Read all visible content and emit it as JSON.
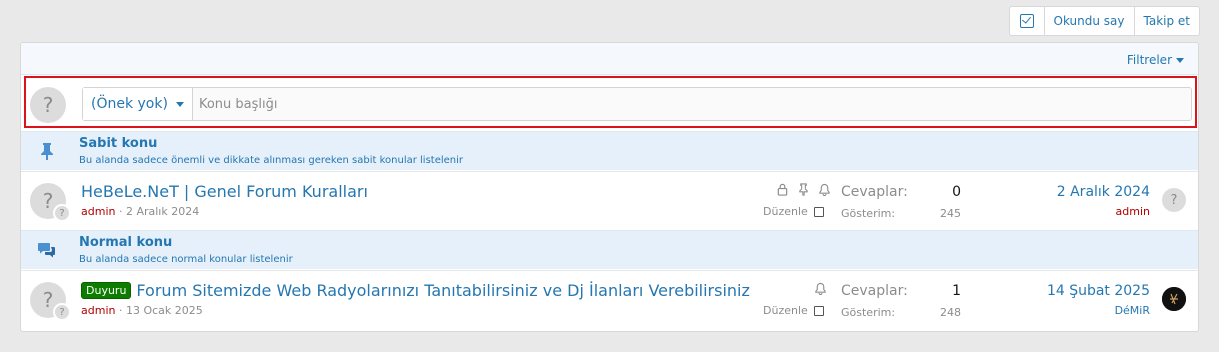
{
  "toolbar": {
    "mark_read_label": "Okundu say",
    "watch_label": "Takip et"
  },
  "filters": {
    "label": "Filtreler"
  },
  "quick_thread": {
    "avatar_glyph": "?",
    "prefix_label": "(Önek yok)",
    "title_placeholder": "Konu başlığı"
  },
  "sections": {
    "sticky": {
      "title": "Sabit konu",
      "description": "Bu alanda sadece önemli ve dikkate alınması gereken sabit konular listelenir"
    },
    "normal": {
      "title": "Normal konu",
      "description": "Bu alanda sadece normal konular listelenir"
    }
  },
  "threads": [
    {
      "avatar_glyph": "?",
      "prefix": "",
      "title": "HeBeLe.NeT | Genel Forum Kuralları",
      "author": "admin",
      "date": "· 2 Aralık 2024",
      "status_icons": [
        "lock-icon",
        "pin-icon",
        "bell-icon"
      ],
      "edit_label": "Düzenle",
      "replies_label": "Cevaplar:",
      "replies": "0",
      "views_label": "Gösterim:",
      "views": "245",
      "last_date": "2 Aralık 2024",
      "last_user": "admin"
    },
    {
      "avatar_glyph": "?",
      "prefix": "Duyuru",
      "title": "Forum Sitemizde Web Radyolarınızı Tanıtabilirsiniz ve Dj İlanları Verebilirsiniz",
      "author": "admin",
      "date": "· 13 Ocak 2025",
      "status_icons": [
        "bell-icon"
      ],
      "edit_label": "Düzenle",
      "replies_label": "Cevaplar:",
      "replies": "1",
      "views_label": "Gösterim:",
      "views": "248",
      "last_date": "14 Şubat 2025",
      "last_user": "DéMiR"
    }
  ],
  "colors": {
    "accent": "#2577b1",
    "highlight_border": "#d9141b",
    "author": "#b30000",
    "prefix_badge": "#0d7d00",
    "section_bg": "#e5f0fa"
  }
}
